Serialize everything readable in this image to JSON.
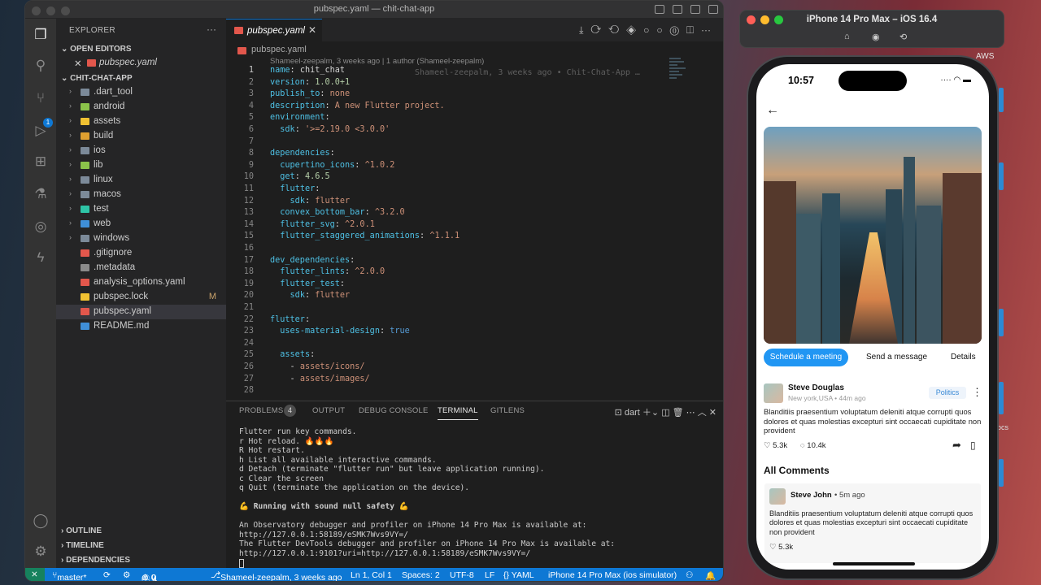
{
  "vscode": {
    "window_title": "pubspec.yaml — chit-chat-app",
    "explorer_label": "EXPLORER",
    "open_editors_label": "OPEN EDITORS",
    "open_editor_file": "pubspec.yaml",
    "project_label": "CHIT-CHAT-APP",
    "tree": [
      {
        "label": ".dart_tool",
        "kind": "folder",
        "color": "#7c8a99"
      },
      {
        "label": "android",
        "kind": "folder",
        "color": "#8bc34a"
      },
      {
        "label": "assets",
        "kind": "folder",
        "color": "#f1c232"
      },
      {
        "label": "build",
        "kind": "folder",
        "color": "#e0a030"
      },
      {
        "label": "ios",
        "kind": "folder",
        "color": "#7c8a99"
      },
      {
        "label": "lib",
        "kind": "folder",
        "color": "#8bc34a"
      },
      {
        "label": "linux",
        "kind": "folder",
        "color": "#7c8a99"
      },
      {
        "label": "macos",
        "kind": "folder",
        "color": "#7c8a99"
      },
      {
        "label": "test",
        "kind": "folder",
        "color": "#2ec4a6"
      },
      {
        "label": "web",
        "kind": "folder",
        "color": "#3f8fd8"
      },
      {
        "label": "windows",
        "kind": "folder",
        "color": "#7c8a99"
      },
      {
        "label": ".gitignore",
        "kind": "file",
        "color": "#e2574c"
      },
      {
        "label": ".metadata",
        "kind": "file",
        "color": "#8a8a8a"
      },
      {
        "label": "analysis_options.yaml",
        "kind": "file",
        "color": "#e2574c"
      },
      {
        "label": "pubspec.lock",
        "kind": "file",
        "color": "#f1c232",
        "badge": "M"
      },
      {
        "label": "pubspec.yaml",
        "kind": "file",
        "color": "#e2574c",
        "selected": true
      },
      {
        "label": "README.md",
        "kind": "file",
        "color": "#3f8fd8"
      }
    ],
    "outline_label": "OUTLINE",
    "timeline_label": "TIMELINE",
    "dependencies_label": "DEPENDENCIES",
    "tab_label": "pubspec.yaml",
    "breadcrumb": "pubspec.yaml",
    "blame_header": "Shameel-zeepalm, 3 weeks ago | 1 author (Shameel-zeepalm)",
    "inline_blame": "Shameel-zeepalm, 3 weeks ago • Chit-Chat-App …",
    "code_lines": [
      "1",
      "2",
      "3",
      "4",
      "5",
      "6",
      "7",
      "8",
      "9",
      "10",
      "11",
      "12",
      "13",
      "14",
      "15",
      "16",
      "17",
      "18",
      "19",
      "20",
      "21",
      "22",
      "23",
      "24",
      "25",
      "26",
      "27",
      "28"
    ],
    "panel_tabs": {
      "problems": "PROBLEMS",
      "problems_count": "4",
      "output": "OUTPUT",
      "debug": "DEBUG CONSOLE",
      "terminal": "TERMINAL",
      "gitlens": "GITLENS",
      "shell": "dart"
    },
    "terminal": [
      "Flutter run key commands.",
      "r Hot reload. 🔥🔥🔥",
      "R Hot restart.",
      "h List all available interactive commands.",
      "d Detach (terminate \"flutter run\" but leave application running).",
      "c Clear the screen",
      "q Quit (terminate the application on the device).",
      "",
      "💪 Running with sound null safety 💪",
      "",
      "An Observatory debugger and profiler on iPhone 14 Pro Max is available at:",
      "http://127.0.0.1:58189/eSMK7Wvs9VY=/",
      "The Flutter DevTools debugger and profiler on iPhone 14 Pro Max is available at:",
      "http://127.0.0.1:9101?uri=http://127.0.0.1:58189/eSMK7Wvs9VY=/"
    ],
    "status": {
      "branch": "master*",
      "errors": "⊗ 0",
      "warnings": "⚠ 0",
      "info": "ⓘ 4",
      "blame": "Shameel-zeepalm, 3 weeks ago",
      "position": "Ln 1, Col 1",
      "spaces": "Spaces: 2",
      "encoding": "UTF-8",
      "eol": "LF",
      "lang": "{} YAML",
      "device": "iPhone 14 Pro Max (ios simulator)"
    }
  },
  "simulator": {
    "title": "iPhone 14 Pro Max – iOS 16.4",
    "time": "10:57",
    "actions": [
      "Schedule a meeting",
      "Send a message",
      "Details"
    ],
    "post": {
      "author": "Steve Douglas",
      "meta": "New york,USA • 44m ago",
      "tag": "Politics",
      "text": "Blanditiis praesentium voluptatum deleniti atque corrupti quos dolores et quas molestias excepturi sint occaecati cupiditate non provident",
      "likes": "5.3k",
      "comments": "10.4k"
    },
    "all_comments_label": "All Comments",
    "comment": {
      "author": "Steve John",
      "meta": "5m ago",
      "text": "Blanditiis praesentium voluptatum deleniti atque corrupti quos dolores et quas molestias excepturi sint occaecati cupiditate non provident",
      "likes": "5.3k"
    }
  },
  "desktop": {
    "aws_label": "AWS",
    "side_label_1": "ocs"
  }
}
